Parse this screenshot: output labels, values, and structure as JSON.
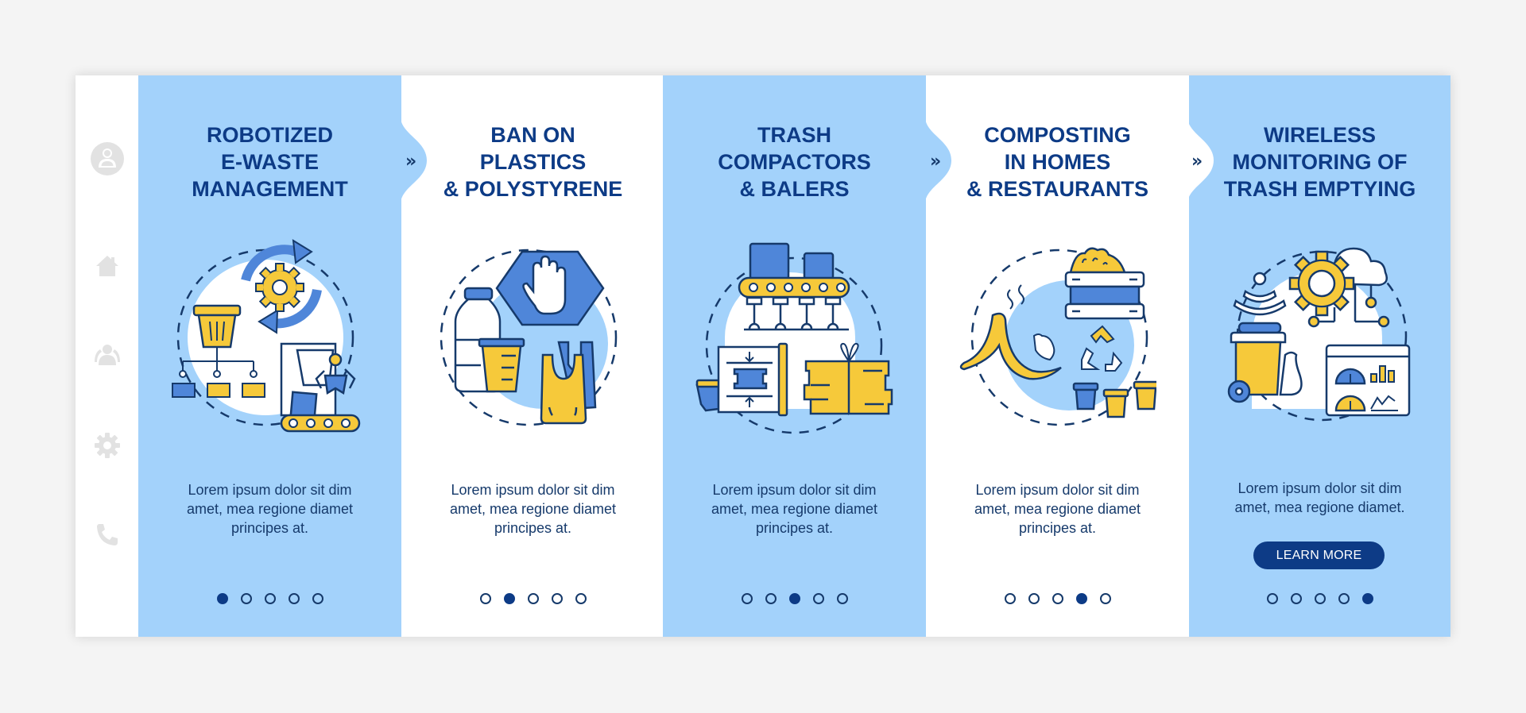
{
  "colors": {
    "page_bg": "#f4f4f4",
    "panel_blue": "#a3d2fb",
    "panel_white": "#ffffff",
    "title": "#0d3b86",
    "text": "#163a6b",
    "icon_blue": "#4f86d9",
    "icon_yellow": "#f6c93a",
    "sidebar_icon": "#e2e2e2",
    "button_bg": "#0d3b86"
  },
  "sidebar": {
    "items": [
      {
        "icon": "user-icon"
      },
      {
        "icon": "home-icon"
      },
      {
        "icon": "group-icon"
      },
      {
        "icon": "gear-icon"
      },
      {
        "icon": "phone-icon"
      }
    ]
  },
  "next_arrow": "»",
  "panels": [
    {
      "title": [
        "ROBOTIZED",
        "E-WASTE",
        "MANAGEMENT"
      ],
      "illustration": "robotized-e-waste-illustration",
      "body": [
        "Lorem ipsum dolor sit dim",
        "amet, mea regione diamet",
        "principes at."
      ],
      "active_dot": 1
    },
    {
      "title": [
        "BAN ON",
        "PLASTICS",
        "& POLYSTYRENE"
      ],
      "illustration": "plastic-ban-illustration",
      "body": [
        "Lorem ipsum dolor sit dim",
        "amet, mea regione diamet",
        "principes at."
      ],
      "active_dot": 2
    },
    {
      "title": [
        "TRASH",
        "COMPACTORS",
        "& BALERS"
      ],
      "illustration": "trash-compactor-illustration",
      "body": [
        "Lorem ipsum dolor sit dim",
        "amet, mea regione diamet",
        "principes at."
      ],
      "active_dot": 3
    },
    {
      "title": [
        "COMPOSTING",
        "IN HOMES",
        "& RESTAURANTS"
      ],
      "illustration": "composting-illustration",
      "body": [
        "Lorem ipsum dolor sit dim",
        "amet, mea regione diamet",
        "principes at."
      ],
      "active_dot": 4
    },
    {
      "title": [
        "WIRELESS",
        "MONITORING OF",
        "TRASH EMPTYING"
      ],
      "illustration": "wireless-monitoring-illustration",
      "body": [
        "Lorem ipsum dolor sit dim",
        "amet, mea regione diamet."
      ],
      "button_label": "LEARN MORE",
      "active_dot": 5
    }
  ],
  "pagination": {
    "total": 5
  }
}
